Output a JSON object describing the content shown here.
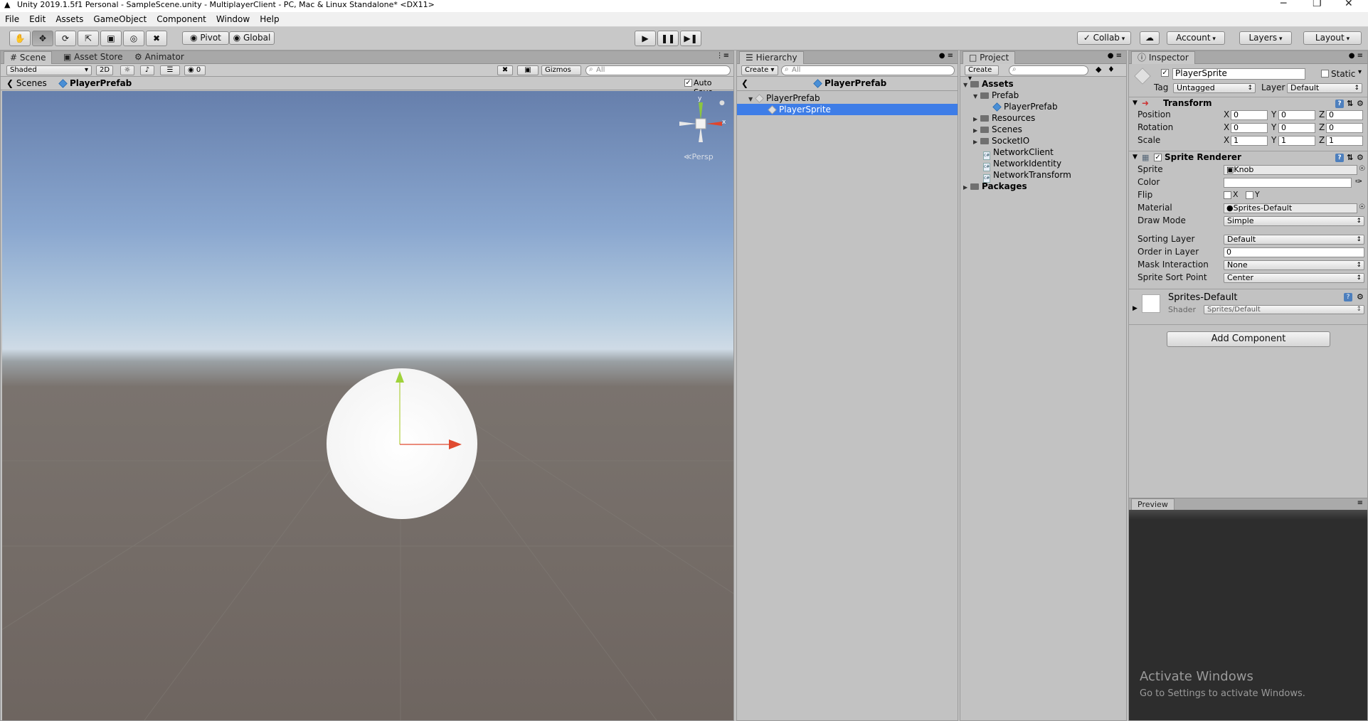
{
  "window": {
    "title": "Unity 2019.1.5f1 Personal - SampleScene.unity - MultiplayerClient - PC, Mac & Linux Standalone* <DX11>",
    "controls": {
      "minimize": "─",
      "maximize": "❐",
      "close": "✕"
    }
  },
  "menu": [
    "File",
    "Edit",
    "Assets",
    "GameObject",
    "Component",
    "Window",
    "Help"
  ],
  "toolbar": {
    "pivot": "Pivot",
    "global": "Global",
    "collab": "Collab",
    "account": "Account",
    "layers": "Layers",
    "layout": "Layout"
  },
  "scene": {
    "tabs": [
      "Scene",
      "Asset Store",
      "Animator"
    ],
    "shading": "Shaded",
    "mode2d": "2D",
    "fx_count": "0",
    "gizmos": "Gizmos",
    "search_placeholder": "All",
    "breadcrumb_root": "Scenes",
    "breadcrumb_prefab": "PlayerPrefab",
    "autosave": "Auto Save",
    "persp": "Persp",
    "gizmo_axis_y": "y",
    "gizmo_axis_x": "x"
  },
  "hierarchy": {
    "tab": "Hierarchy",
    "create": "Create",
    "search_placeholder": "All",
    "header": "PlayerPrefab",
    "items": [
      "PlayerPrefab",
      "PlayerSprite"
    ]
  },
  "project": {
    "tab": "Project",
    "create": "Create",
    "assets": "Assets",
    "prefab_folder": "Prefab",
    "player_prefab": "PlayerPrefab",
    "resources": "Resources",
    "scenes": "Scenes",
    "socketio": "SocketIO",
    "scripts": [
      "NetworkClient",
      "NetworkIdentity",
      "NetworkTransform"
    ],
    "packages": "Packages"
  },
  "inspector": {
    "tab": "Inspector",
    "object_name": "PlayerSprite",
    "static": "Static",
    "tag_label": "Tag",
    "tag_value": "Untagged",
    "layer_label": "Layer",
    "layer_value": "Default",
    "transform": {
      "title": "Transform",
      "rows": [
        {
          "label": "Position",
          "x": "0",
          "y": "0",
          "z": "0"
        },
        {
          "label": "Rotation",
          "x": "0",
          "y": "0",
          "z": "0"
        },
        {
          "label": "Scale",
          "x": "1",
          "y": "1",
          "z": "1"
        }
      ]
    },
    "sprite_renderer": {
      "title": "Sprite Renderer",
      "sprite_label": "Sprite",
      "sprite_value": "Knob",
      "color_label": "Color",
      "flip_label": "Flip",
      "flip_x": "X",
      "flip_y": "Y",
      "material_label": "Material",
      "material_value": "Sprites-Default",
      "draw_mode_label": "Draw Mode",
      "draw_mode_value": "Simple",
      "sorting_layer_label": "Sorting Layer",
      "sorting_layer_value": "Default",
      "order_label": "Order in Layer",
      "order_value": "0",
      "mask_label": "Mask Interaction",
      "mask_value": "None",
      "sort_point_label": "Sprite Sort Point",
      "sort_point_value": "Center"
    },
    "material": {
      "name": "Sprites-Default",
      "shader_label": "Shader",
      "shader_value": "Sprites/Default"
    },
    "add_component": "Add Component",
    "preview": "Preview"
  },
  "watermark": {
    "line1": "Activate Windows",
    "line2": "Go to Settings to activate Windows."
  }
}
